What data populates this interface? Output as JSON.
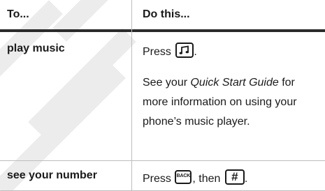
{
  "table": {
    "header": {
      "col1": "To...",
      "col2": "Do this..."
    },
    "rows": [
      {
        "action": "play music",
        "instruction_prefix": "Press",
        "instruction_suffix": ".",
        "key_icon": "music-key-icon",
        "note_prefix": "See your ",
        "note_italic": "Quick Start Guide",
        "note_suffix": " for more information on using your phone’s music player."
      },
      {
        "action": "see your number",
        "instruction_prefix": "Press",
        "key1_icon": "back-key-icon",
        "key1_text": "BACK",
        "middle": ", then",
        "key2_icon": "hash-key-icon",
        "key2_text": "#",
        "instruction_suffix": "."
      }
    ]
  },
  "colors": {
    "header_rule": "#2b2b2b",
    "grid_line": "#bdbdbd",
    "watermark": "#ececec"
  }
}
